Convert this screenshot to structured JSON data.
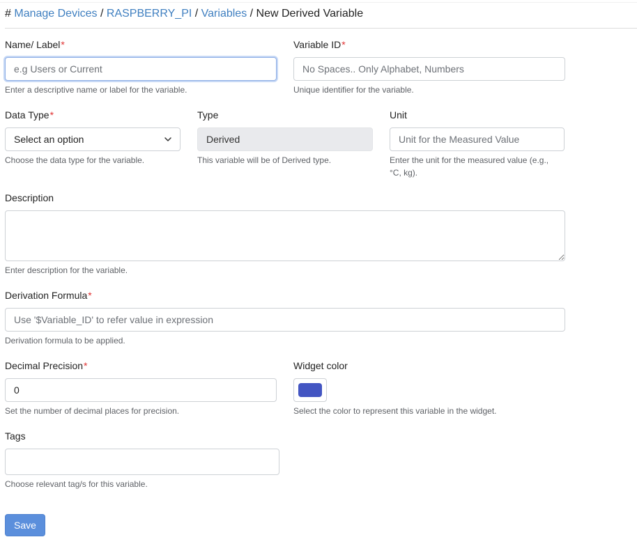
{
  "breadcrumb": {
    "hash": "#",
    "items": [
      {
        "label": "Manage Devices"
      },
      {
        "label": "RASPBERRY_PI"
      },
      {
        "label": "Variables"
      }
    ],
    "current": "New Derived Variable",
    "separator": "/"
  },
  "form": {
    "name": {
      "label": "Name/ Label",
      "required_mark": "*",
      "placeholder": "e.g Users or Current",
      "value": "",
      "help": "Enter a descriptive name or label for the variable."
    },
    "variable_id": {
      "label": "Variable ID",
      "required_mark": "*",
      "placeholder": "No Spaces.. Only Alphabet, Numbers",
      "value": "",
      "help": "Unique identifier for the variable."
    },
    "data_type": {
      "label": "Data Type",
      "required_mark": "*",
      "selected": "Select an option",
      "help": "Choose the data type for the variable."
    },
    "type": {
      "label": "Type",
      "value": "Derived",
      "help": "This variable will be of Derived type."
    },
    "unit": {
      "label": "Unit",
      "placeholder": "Unit for the Measured Value",
      "value": "",
      "help_line1": "Enter the unit for the measured value (e.g.,",
      "help_line2": "°C, kg)."
    },
    "description": {
      "label": "Description",
      "value": "",
      "help": "Enter description for the variable."
    },
    "formula": {
      "label": "Derivation Formula",
      "required_mark": "*",
      "placeholder": "Use '$Variable_ID' to refer value in expression",
      "value": "",
      "help": "Derivation formula to be applied."
    },
    "precision": {
      "label": "Decimal Precision",
      "required_mark": "*",
      "value": "0",
      "help": "Set the number of decimal places for precision."
    },
    "widget_color": {
      "label": "Widget color",
      "color": "#4355c2",
      "help": "Select the color to represent this variable in the widget."
    },
    "tags": {
      "label": "Tags",
      "value": "",
      "help": "Choose relevant tag/s for this variable."
    }
  },
  "save_label": "Save",
  "icons": {
    "select_arrow": "chevron-down-icon"
  }
}
